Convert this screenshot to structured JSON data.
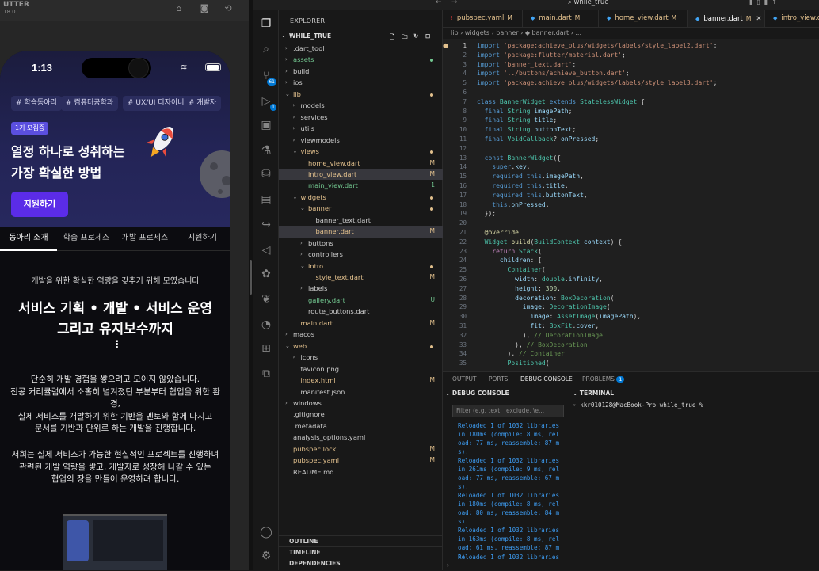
{
  "simulator": {
    "title": "UTTER",
    "subtitle": "18.0",
    "home_icon": "home-icon",
    "screenshot_icon": "camera-icon",
    "rotate_icon": "rotate-icon"
  },
  "phone": {
    "status_time": "1:13",
    "tags": [
      "# 학습동아리",
      "# 컴퓨터공학과",
      "# UX/UI 디자이너",
      "# 개발자"
    ],
    "badge": "1기 모집중",
    "hero_title_1": "열정 하나로 성취하는",
    "hero_title_2": "가장 확실한 방법",
    "apply_button": "지원하기",
    "tabs": [
      "동아리 소개",
      "학습 프로세스",
      "개발 프로세스",
      "지원하기"
    ],
    "intro_lead": "개발을 위한 확실한 역량을 갖추기 위해 모였습니다",
    "intro_head_1": "서비스 기획 • 개발 • 서비스 운영",
    "intro_head_2": "그리고 유지보수까지",
    "dots": "⋮",
    "para1": [
      "단순히 개발 경험을 쌓으려고 모이지 않았습니다.",
      "전공 커리큘럼에서 소홀히 넘겨졌던 부분부터 협업을 위한 환",
      "경,",
      "실제 서비스를 개발하기 위한 기반을 멘토와 함께 다지고",
      "문서를 기반과 단위로 하는 개발을 진행합니다."
    ],
    "para2": [
      "저희는 실제 서비스가 가능한 현실적인 프로젝트를 진행하며",
      "관련된 개발 역량을 쌓고, 개발자로 성장해 나갈 수 있는",
      "협업의 장을 만들어 운영하려 합니다."
    ]
  },
  "vscode": {
    "search_box": "while_true",
    "explorer_title": "EXPLORER",
    "workspace": "WHILE_TRUE",
    "scm_badge": "61",
    "run_badge": "1",
    "tree": [
      {
        "label": ".dart_tool",
        "type": "folder",
        "depth": 1,
        "color": "#cccccc"
      },
      {
        "label": "assets",
        "type": "folder",
        "depth": 1,
        "color": "#73c991",
        "dot": "#73c991"
      },
      {
        "label": "build",
        "type": "folder",
        "depth": 1,
        "color": "#cccccc"
      },
      {
        "label": "ios",
        "type": "folder",
        "depth": 1,
        "color": "#cccccc"
      },
      {
        "label": "lib",
        "type": "folder-open",
        "depth": 1,
        "color": "#e2c08d",
        "dot": "#e2c08d"
      },
      {
        "label": "models",
        "type": "folder",
        "depth": 2,
        "color": "#cccccc"
      },
      {
        "label": "services",
        "type": "folder",
        "depth": 2,
        "color": "#cccccc"
      },
      {
        "label": "utils",
        "type": "folder",
        "depth": 2,
        "color": "#cccccc"
      },
      {
        "label": "viewmodels",
        "type": "folder",
        "depth": 2,
        "color": "#cccccc"
      },
      {
        "label": "views",
        "type": "folder-open",
        "depth": 2,
        "color": "#e2c08d",
        "dot": "#e2c08d"
      },
      {
        "label": "home_view.dart",
        "type": "file",
        "depth": 3,
        "color": "#e2c08d",
        "status": "M"
      },
      {
        "label": "intro_view.dart",
        "type": "file",
        "depth": 3,
        "color": "#e2c08d",
        "status": "M",
        "hover": true
      },
      {
        "label": "main_view.dart",
        "type": "file",
        "depth": 3,
        "color": "#73c991",
        "status": "1"
      },
      {
        "label": "widgets",
        "type": "folder-open",
        "depth": 2,
        "color": "#e2c08d",
        "dot": "#e2c08d"
      },
      {
        "label": "banner",
        "type": "folder-open",
        "depth": 3,
        "color": "#e2c08d",
        "dot": "#e2c08d"
      },
      {
        "label": "banner_text.dart",
        "type": "file",
        "depth": 4,
        "color": "#cccccc"
      },
      {
        "label": "banner.dart",
        "type": "file",
        "depth": 4,
        "color": "#e2c08d",
        "status": "M",
        "selected": true
      },
      {
        "label": "buttons",
        "type": "folder",
        "depth": 3,
        "color": "#cccccc"
      },
      {
        "label": "controllers",
        "type": "folder",
        "depth": 3,
        "color": "#cccccc"
      },
      {
        "label": "intro",
        "type": "folder-open",
        "depth": 3,
        "color": "#e2c08d",
        "dot": "#e2c08d"
      },
      {
        "label": "style_text.dart",
        "type": "file",
        "depth": 4,
        "color": "#e2c08d",
        "status": "M"
      },
      {
        "label": "labels",
        "type": "folder",
        "depth": 3,
        "color": "#cccccc"
      },
      {
        "label": "gallery.dart",
        "type": "file",
        "depth": 3,
        "color": "#73c991",
        "status": "U"
      },
      {
        "label": "route_buttons.dart",
        "type": "file",
        "depth": 3,
        "color": "#cccccc"
      },
      {
        "label": "main.dart",
        "type": "file",
        "depth": 2,
        "color": "#e2c08d",
        "status": "M"
      },
      {
        "label": "macos",
        "type": "folder",
        "depth": 1,
        "color": "#cccccc"
      },
      {
        "label": "web",
        "type": "folder-open",
        "depth": 1,
        "color": "#e2c08d",
        "dot": "#e2c08d"
      },
      {
        "label": "icons",
        "type": "folder",
        "depth": 2,
        "color": "#cccccc"
      },
      {
        "label": "favicon.png",
        "type": "file",
        "depth": 2,
        "color": "#cccccc"
      },
      {
        "label": "index.html",
        "type": "file",
        "depth": 2,
        "color": "#e2c08d",
        "status": "M"
      },
      {
        "label": "manifest.json",
        "type": "file",
        "depth": 2,
        "color": "#cccccc"
      },
      {
        "label": "windows",
        "type": "folder",
        "depth": 1,
        "color": "#cccccc"
      },
      {
        "label": ".gitignore",
        "type": "file",
        "depth": 1,
        "color": "#cccccc"
      },
      {
        "label": ".metadata",
        "type": "file",
        "depth": 1,
        "color": "#cccccc"
      },
      {
        "label": "analysis_options.yaml",
        "type": "file",
        "depth": 1,
        "color": "#cccccc"
      },
      {
        "label": "pubspec.lock",
        "type": "file",
        "depth": 1,
        "color": "#e2c08d",
        "status": "M"
      },
      {
        "label": "pubspec.yaml",
        "type": "file",
        "depth": 1,
        "color": "#e2c08d",
        "status": "M"
      },
      {
        "label": "README.md",
        "type": "file",
        "depth": 1,
        "color": "#cccccc"
      }
    ],
    "sections": [
      "OUTLINE",
      "TIMELINE",
      "DEPENDENCIES"
    ],
    "tabs": [
      {
        "label": "pubspec.yaml",
        "mark": "M",
        "icon": "!"
      },
      {
        "label": "main.dart",
        "mark": "M",
        "icon": "◆"
      },
      {
        "label": "home_view.dart",
        "mark": "M",
        "icon": "◆"
      },
      {
        "label": "banner.dart",
        "mark": "M",
        "icon": "◆",
        "active": true
      },
      {
        "label": "intro_view.da",
        "mark": "",
        "icon": "◆"
      }
    ],
    "breadcrumb": "lib › widgets › banner › ◆ banner.dart › ...",
    "code": [
      [
        [
          "kw",
          "import "
        ],
        [
          "str",
          "'package:achieve_plus/widgets/labels/style_label2.dart'"
        ],
        [
          "p",
          ";"
        ]
      ],
      [
        [
          "kw",
          "import "
        ],
        [
          "str",
          "'package:flutter/material.dart'"
        ],
        [
          "p",
          ";"
        ]
      ],
      [
        [
          "kw",
          "import "
        ],
        [
          "str",
          "'banner_text.dart'"
        ],
        [
          "p",
          ";"
        ]
      ],
      [
        [
          "kw",
          "import "
        ],
        [
          "str",
          "'../buttons/achieve_button.dart'"
        ],
        [
          "p",
          ";"
        ]
      ],
      [
        [
          "kw",
          "import "
        ],
        [
          "str",
          "'package:achieve_plus/widgets/labels/style_label3.dart'"
        ],
        [
          "p",
          ";"
        ]
      ],
      [],
      [
        [
          "kw",
          "class "
        ],
        [
          "ty",
          "BannerWidget "
        ],
        [
          "kw",
          "extends "
        ],
        [
          "ty",
          "StatelessWidget "
        ],
        [
          "p",
          "{"
        ]
      ],
      [
        [
          "p",
          "  "
        ],
        [
          "kw",
          "final "
        ],
        [
          "ty",
          "String "
        ],
        [
          "pr",
          "imagePath"
        ],
        [
          "p",
          ";"
        ]
      ],
      [
        [
          "p",
          "  "
        ],
        [
          "kw",
          "final "
        ],
        [
          "ty",
          "String "
        ],
        [
          "pr",
          "title"
        ],
        [
          "p",
          ";"
        ]
      ],
      [
        [
          "p",
          "  "
        ],
        [
          "kw",
          "final "
        ],
        [
          "ty",
          "String "
        ],
        [
          "pr",
          "buttonText"
        ],
        [
          "p",
          ";"
        ]
      ],
      [
        [
          "p",
          "  "
        ],
        [
          "kw",
          "final "
        ],
        [
          "ty",
          "VoidCallback"
        ],
        [
          "p",
          "? "
        ],
        [
          "pr",
          "onPressed"
        ],
        [
          "p",
          ";"
        ]
      ],
      [],
      [
        [
          "p",
          "  "
        ],
        [
          "kw",
          "const "
        ],
        [
          "ty",
          "BannerWidget"
        ],
        [
          "p",
          "({"
        ]
      ],
      [
        [
          "p",
          "    "
        ],
        [
          "kw",
          "super"
        ],
        [
          "p",
          "."
        ],
        [
          "pr",
          "key"
        ],
        [
          "p",
          ","
        ]
      ],
      [
        [
          "p",
          "    "
        ],
        [
          "kw",
          "required "
        ],
        [
          "kw",
          "this"
        ],
        [
          "p",
          "."
        ],
        [
          "pr",
          "imagePath"
        ],
        [
          "p",
          ","
        ]
      ],
      [
        [
          "p",
          "    "
        ],
        [
          "kw",
          "required "
        ],
        [
          "kw",
          "this"
        ],
        [
          "p",
          "."
        ],
        [
          "pr",
          "title"
        ],
        [
          "p",
          ","
        ]
      ],
      [
        [
          "p",
          "    "
        ],
        [
          "kw",
          "required "
        ],
        [
          "kw",
          "this"
        ],
        [
          "p",
          "."
        ],
        [
          "pr",
          "buttonText"
        ],
        [
          "p",
          ","
        ]
      ],
      [
        [
          "p",
          "    "
        ],
        [
          "kw",
          "this"
        ],
        [
          "p",
          "."
        ],
        [
          "pr",
          "onPressed"
        ],
        [
          "p",
          ","
        ]
      ],
      [
        [
          "p",
          "  });"
        ]
      ],
      [],
      [
        [
          "p",
          "  "
        ],
        [
          "fn",
          "@override"
        ]
      ],
      [
        [
          "p",
          "  "
        ],
        [
          "ty",
          "Widget "
        ],
        [
          "fn",
          "build"
        ],
        [
          "p",
          "("
        ],
        [
          "ty",
          "BuildContext "
        ],
        [
          "pr",
          "context"
        ],
        [
          "p",
          ") {"
        ]
      ],
      [
        [
          "p",
          "    "
        ],
        [
          "ctl",
          "return "
        ],
        [
          "ty",
          "Stack"
        ],
        [
          "p",
          "("
        ]
      ],
      [
        [
          "p",
          "      "
        ],
        [
          "pr",
          "children"
        ],
        [
          "p",
          ": ["
        ]
      ],
      [
        [
          "p",
          "        "
        ],
        [
          "ty",
          "Container"
        ],
        [
          "p",
          "("
        ]
      ],
      [
        [
          "p",
          "          "
        ],
        [
          "pr",
          "width"
        ],
        [
          "p",
          ": "
        ],
        [
          "ty",
          "double"
        ],
        [
          "p",
          "."
        ],
        [
          "pr",
          "infinity"
        ],
        [
          "p",
          ","
        ]
      ],
      [
        [
          "p",
          "          "
        ],
        [
          "pr",
          "height"
        ],
        [
          "p",
          ": "
        ],
        [
          "num",
          "300"
        ],
        [
          "p",
          ","
        ]
      ],
      [
        [
          "p",
          "          "
        ],
        [
          "pr",
          "decoration"
        ],
        [
          "p",
          ": "
        ],
        [
          "ty",
          "BoxDecoration"
        ],
        [
          "p",
          "("
        ]
      ],
      [
        [
          "p",
          "            "
        ],
        [
          "pr",
          "image"
        ],
        [
          "p",
          ": "
        ],
        [
          "ty",
          "DecorationImage"
        ],
        [
          "p",
          "("
        ]
      ],
      [
        [
          "p",
          "              "
        ],
        [
          "pr",
          "image"
        ],
        [
          "p",
          ": "
        ],
        [
          "ty",
          "AssetImage"
        ],
        [
          "p",
          "("
        ],
        [
          "pr",
          "imagePath"
        ],
        [
          "p",
          "),"
        ]
      ],
      [
        [
          "p",
          "              "
        ],
        [
          "pr",
          "fit"
        ],
        [
          "p",
          ": "
        ],
        [
          "ty",
          "BoxFit"
        ],
        [
          "p",
          "."
        ],
        [
          "pr",
          "cover"
        ],
        [
          "p",
          ","
        ]
      ],
      [
        [
          "p",
          "            ), "
        ],
        [
          "cm",
          "// DecorationImage"
        ]
      ],
      [
        [
          "p",
          "          ), "
        ],
        [
          "cm",
          "// BoxDecoration"
        ]
      ],
      [
        [
          "p",
          "        ), "
        ],
        [
          "cm",
          "// Container"
        ]
      ],
      [
        [
          "p",
          "        "
        ],
        [
          "ty",
          "Positioned"
        ],
        [
          "p",
          "("
        ]
      ]
    ],
    "panel_tabs": [
      "OUTPUT",
      "PORTS",
      "DEBUG CONSOLE",
      "PROBLEMS"
    ],
    "problems_count": "1",
    "debug_title": "DEBUG CONSOLE",
    "filter_placeholder": "Filter (e.g. text, !exclude, \\e...",
    "logs": [
      "Reloaded 1 of 1032 libraries\nin 180ms (compile: 8 ms, rel\noad: 77 ms, reassemble: 87 m\ns).",
      "Reloaded 1 of 1032 libraries\nin 261ms (compile: 9 ms, rel\noad: 77 ms, reassemble: 67 m\ns).",
      "Reloaded 1 of 1032 libraries\nin 180ms (compile: 8 ms, rel\noad: 80 ms, reassemble: 84 m\ns).",
      "Reloaded 1 of 1032 libraries\nin 163ms (compile: 8 ms, rel\noad: 61 ms, reassemble: 87 m\ns)."
    ],
    "partial_log": "Reloaded 1 of 1032 libraries",
    "terminal_title": "TERMINAL",
    "terminal_line": "kkr010128@MacBook-Pro while_true %"
  }
}
